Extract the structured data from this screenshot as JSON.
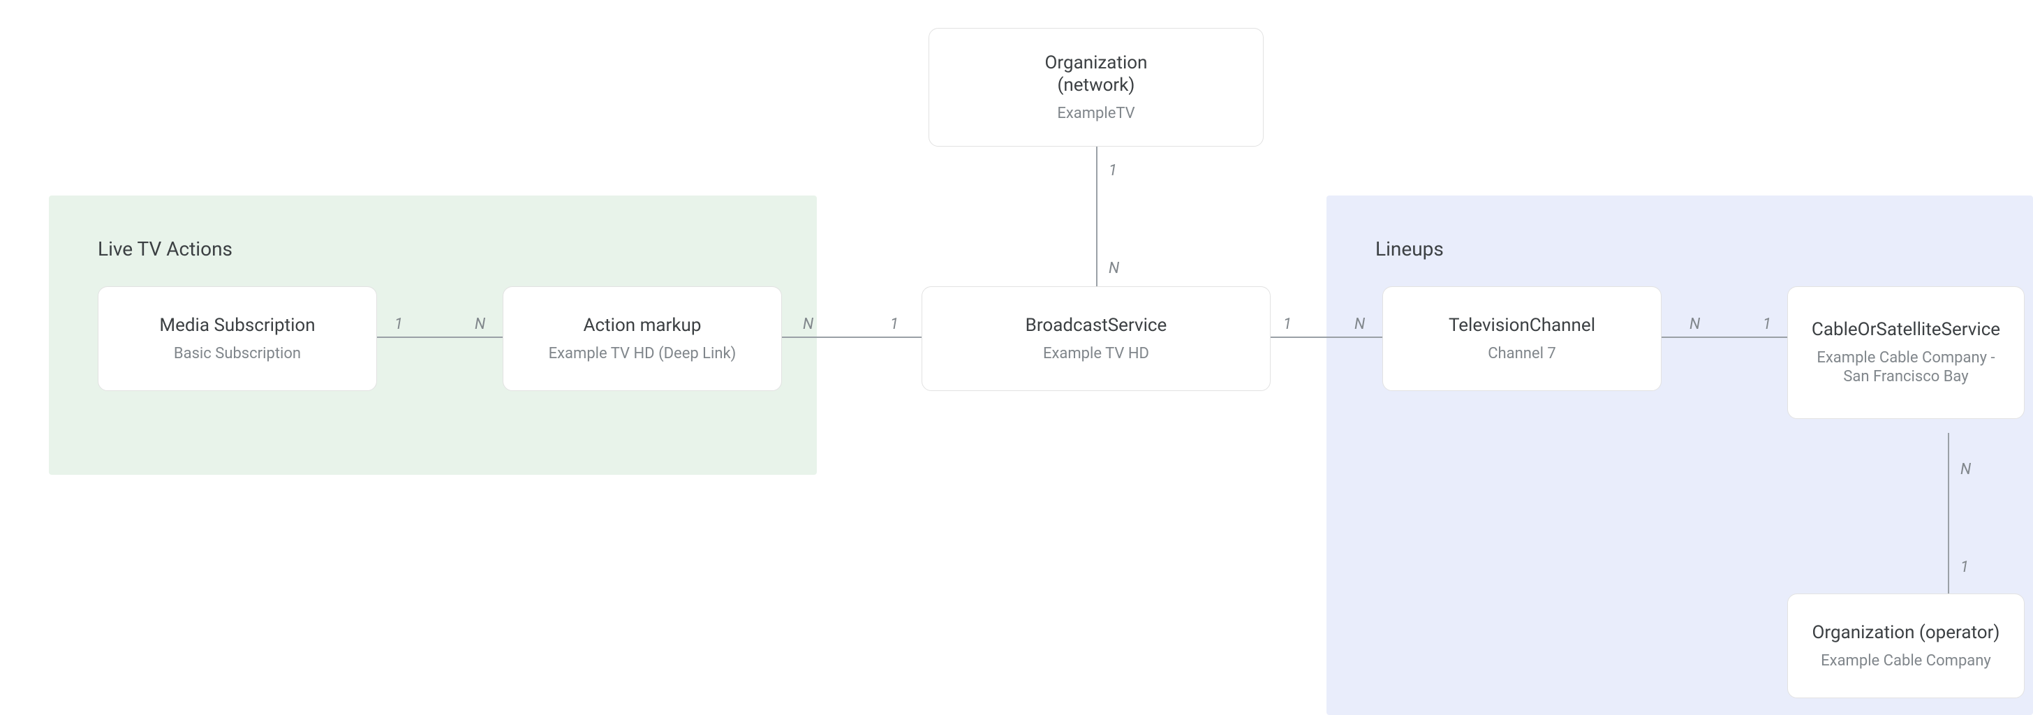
{
  "regions": {
    "liveTvActions": {
      "title": "Live TV Actions"
    },
    "lineups": {
      "title": "Lineups"
    }
  },
  "nodes": {
    "org_network": {
      "title_line1": "Organization",
      "title_line2": "(network)",
      "sub": "ExampleTV"
    },
    "media_subscription": {
      "title": "Media Subscription",
      "sub": "Basic Subscription"
    },
    "action_markup": {
      "title": "Action markup",
      "sub": "Example TV HD (Deep Link)"
    },
    "broadcast_service": {
      "title": "BroadcastService",
      "sub": "Example TV HD"
    },
    "television_channel": {
      "title": "TelevisionChannel",
      "sub": "Channel 7"
    },
    "cable_service": {
      "title": "CableOrSatelliteService",
      "sub_line1": "Example Cable Company -",
      "sub_line2": "San Francisco Bay"
    },
    "org_operator": {
      "title": "Organization (operator)",
      "sub": "Example Cable Company"
    }
  },
  "card": {
    "one": "1",
    "n": "N"
  }
}
